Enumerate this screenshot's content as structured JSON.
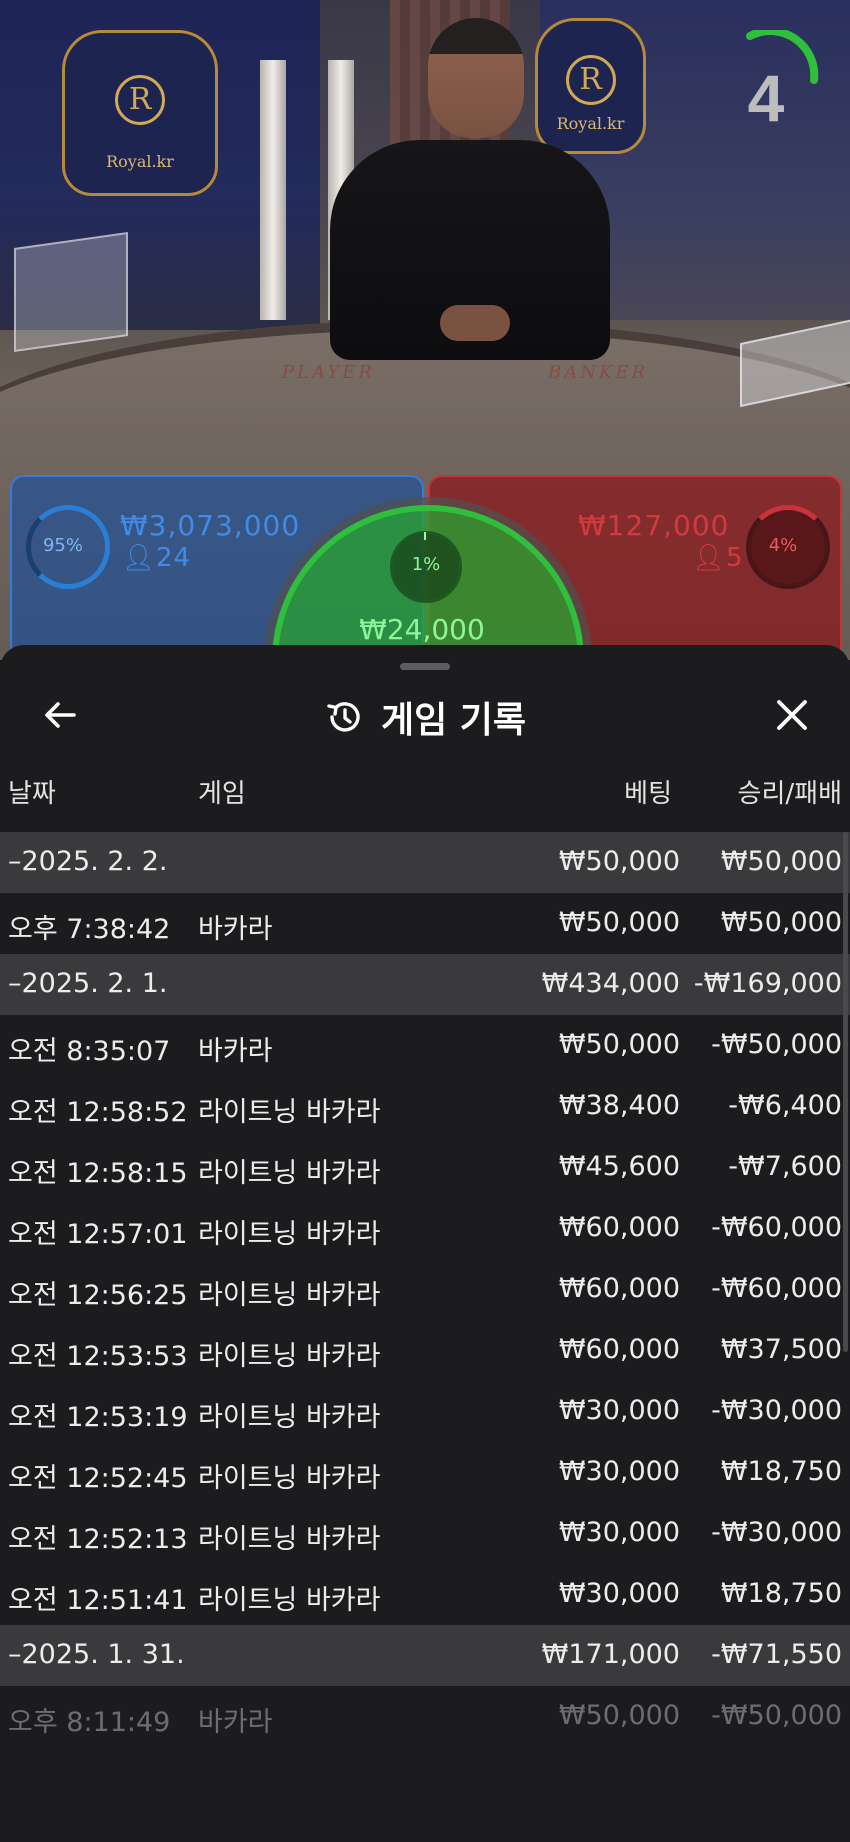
{
  "video": {
    "brand_left": "Royal.kr",
    "brand_right": "Royal.kr",
    "crest_letter": "R",
    "table_player_label": "PLAYER",
    "table_banker_label": "BANKER",
    "countdown": "4"
  },
  "bets": {
    "player": {
      "percent": "95%",
      "amount": "₩3,073,000",
      "players": "24",
      "color": "#3f8be6"
    },
    "banker": {
      "percent": "4%",
      "amount": "₩127,000",
      "players": "5",
      "color": "#d23a40"
    },
    "tie": {
      "percent": "1%",
      "amount": "₩24,000",
      "color": "#2fbf3c"
    }
  },
  "history": {
    "title": "게임 기록",
    "back_icon": "arrow-left-icon",
    "title_icon": "history-icon",
    "close_icon": "close-icon",
    "columns": {
      "date": "날짜",
      "game": "게임",
      "bet": "베팅",
      "result": "승리/패배"
    },
    "rows": [
      {
        "type": "group",
        "date": "–2025. 2. 2.",
        "game": "",
        "bet": "₩50,000",
        "result": "₩50,000"
      },
      {
        "type": "item",
        "date": "오후 7:38:42",
        "game": "바카라",
        "bet": "₩50,000",
        "result": "₩50,000"
      },
      {
        "type": "group",
        "date": "–2025. 2. 1.",
        "game": "",
        "bet": "₩434,000",
        "result": "-₩169,000"
      },
      {
        "type": "item",
        "date": "오전 8:35:07",
        "game": "바카라",
        "bet": "₩50,000",
        "result": "-₩50,000"
      },
      {
        "type": "item",
        "date": "오전 12:58:52",
        "game": "라이트닝 바카라",
        "bet": "₩38,400",
        "result": "-₩6,400"
      },
      {
        "type": "item",
        "date": "오전 12:58:15",
        "game": "라이트닝 바카라",
        "bet": "₩45,600",
        "result": "-₩7,600"
      },
      {
        "type": "item",
        "date": "오전 12:57:01",
        "game": "라이트닝 바카라",
        "bet": "₩60,000",
        "result": "-₩60,000"
      },
      {
        "type": "item",
        "date": "오전 12:56:25",
        "game": "라이트닝 바카라",
        "bet": "₩60,000",
        "result": "-₩60,000"
      },
      {
        "type": "item",
        "date": "오전 12:53:53",
        "game": "라이트닝 바카라",
        "bet": "₩60,000",
        "result": "₩37,500"
      },
      {
        "type": "item",
        "date": "오전 12:53:19",
        "game": "라이트닝 바카라",
        "bet": "₩30,000",
        "result": "-₩30,000"
      },
      {
        "type": "item",
        "date": "오전 12:52:45",
        "game": "라이트닝 바카라",
        "bet": "₩30,000",
        "result": "₩18,750"
      },
      {
        "type": "item",
        "date": "오전 12:52:13",
        "game": "라이트닝 바카라",
        "bet": "₩30,000",
        "result": "-₩30,000"
      },
      {
        "type": "item",
        "date": "오전 12:51:41",
        "game": "라이트닝 바카라",
        "bet": "₩30,000",
        "result": "₩18,750"
      },
      {
        "type": "group",
        "date": "–2025. 1. 31.",
        "game": "",
        "bet": "₩171,000",
        "result": "-₩71,550"
      },
      {
        "type": "item",
        "date": "오후 8:11:49",
        "game": "바카라",
        "bet": "₩50,000",
        "result": "-₩50,000"
      }
    ]
  }
}
